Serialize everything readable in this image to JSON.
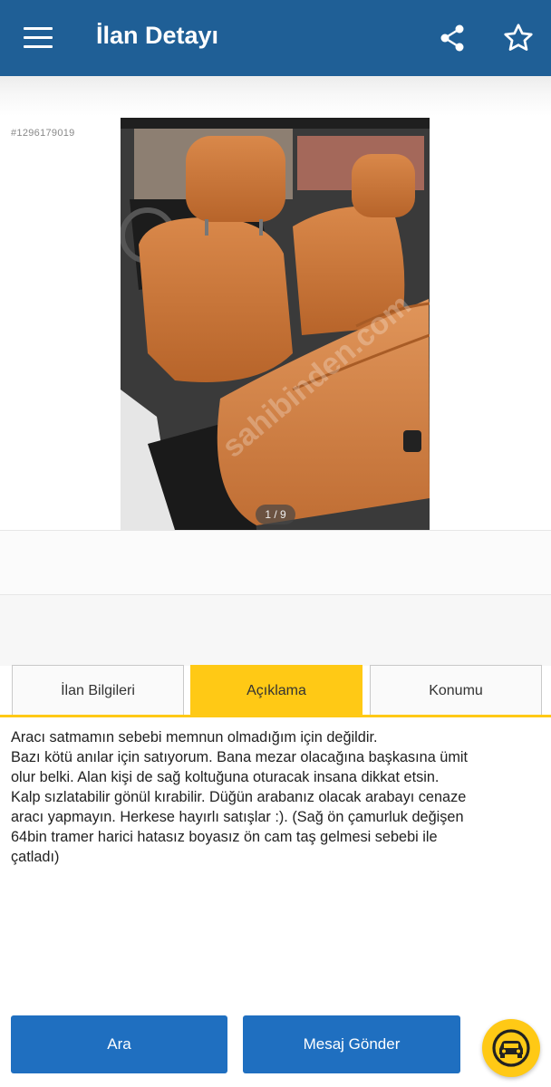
{
  "appbar": {
    "title": "İlan Detayı",
    "background": "#1f5f96",
    "menu_icon": "hamburger-menu-icon",
    "share_icon": "share-icon",
    "favorite_icon": "star-outline-icon"
  },
  "listing": {
    "id": "#1296179019",
    "photo": {
      "watermark": "sahibinden.com",
      "counter": "1 / 9"
    }
  },
  "tabs": [
    {
      "label": "İlan Bilgileri",
      "active": false
    },
    {
      "label": "Açıklama",
      "active": true
    },
    {
      "label": "Konumu",
      "active": false
    }
  ],
  "description": {
    "lines": [
      "Aracı satmamın sebebi memnun olmadığım için değildir.",
      "Bazı kötü anılar için satıyorum. Bana mezar olacağına başkasına ümit",
      "olur belki. Alan kişi de sağ koltuğuna oturacak insana dikkat etsin.",
      "Kalp sızlatabilir gönül kırabilir. Düğün arabanız olacak arabayı cenaze",
      "aracı yapmayın. Herkese hayırlı satışlar :). (Sağ ön çamurluk değişen",
      "64bin tramer harici hatasız boyasız ön cam taş gelmesi sebebi ile",
      "çatladı)"
    ]
  },
  "actions": {
    "call_label": "Ara",
    "message_label": "Mesaj Gönder",
    "fab_icon": "car-assistant-icon"
  },
  "colors": {
    "accent": "#ffc915",
    "primary": "#1f5f96",
    "button": "#1f6fc0"
  }
}
